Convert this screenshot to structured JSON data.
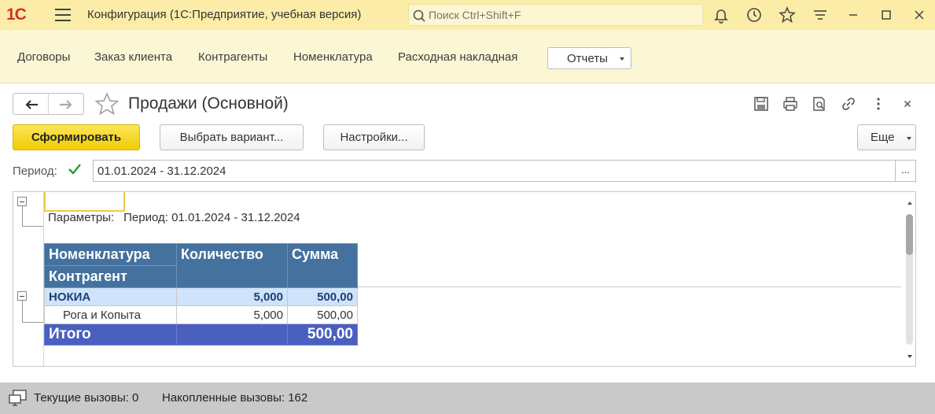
{
  "app": {
    "logo_text": "1С",
    "title": "Конфигурация  (1С:Предприятие, учебная версия)",
    "search_placeholder": "Поиск Ctrl+Shift+F"
  },
  "titlebar_icons": [
    "bell-icon",
    "history-icon",
    "star-icon",
    "funnel-menu-icon",
    "minimize-icon",
    "maximize-icon",
    "close-icon"
  ],
  "sections": {
    "items": [
      "Договоры",
      "Заказ клиента",
      "Контрагенты",
      "Номенклатура",
      "Расходная накладная"
    ],
    "reports_label": "Отчеты"
  },
  "form": {
    "title": "Продажи (Основной)",
    "buttons": {
      "generate": "Сформировать",
      "choose_variant": "Выбрать вариант...",
      "settings": "Настройки...",
      "more": "Еще"
    },
    "period": {
      "label": "Период:",
      "checked": true,
      "value": "01.01.2024 - 31.12.2024",
      "choose": "..."
    }
  },
  "report": {
    "params_label": "Параметры:",
    "params_value": "Период: 01.01.2024 - 31.12.2024",
    "headers": {
      "nomenclature": "Номенклатура",
      "counterparty": "Контрагент",
      "quantity": "Количество",
      "amount": "Сумма"
    },
    "group": {
      "name": "НОКИА",
      "quantity": "5,000",
      "amount": "500,00"
    },
    "detail": {
      "name": "Рога и Копыта",
      "quantity": "5,000",
      "amount": "500,00"
    },
    "total": {
      "label": "Итого",
      "amount": "500,00"
    }
  },
  "status": {
    "current_calls": "Текущие вызовы: 0",
    "accumulated_calls": "Накопленные вызовы: 162"
  },
  "colors": {
    "titlebar_bg": "#fbeda7",
    "sections_bg": "#fbf7d4",
    "primary_button": "#f2cd00",
    "table_header": "#45719f",
    "group_row": "#cfe3fa",
    "total_row": "#4a5fbf",
    "statusbar": "#c9c9c9"
  }
}
